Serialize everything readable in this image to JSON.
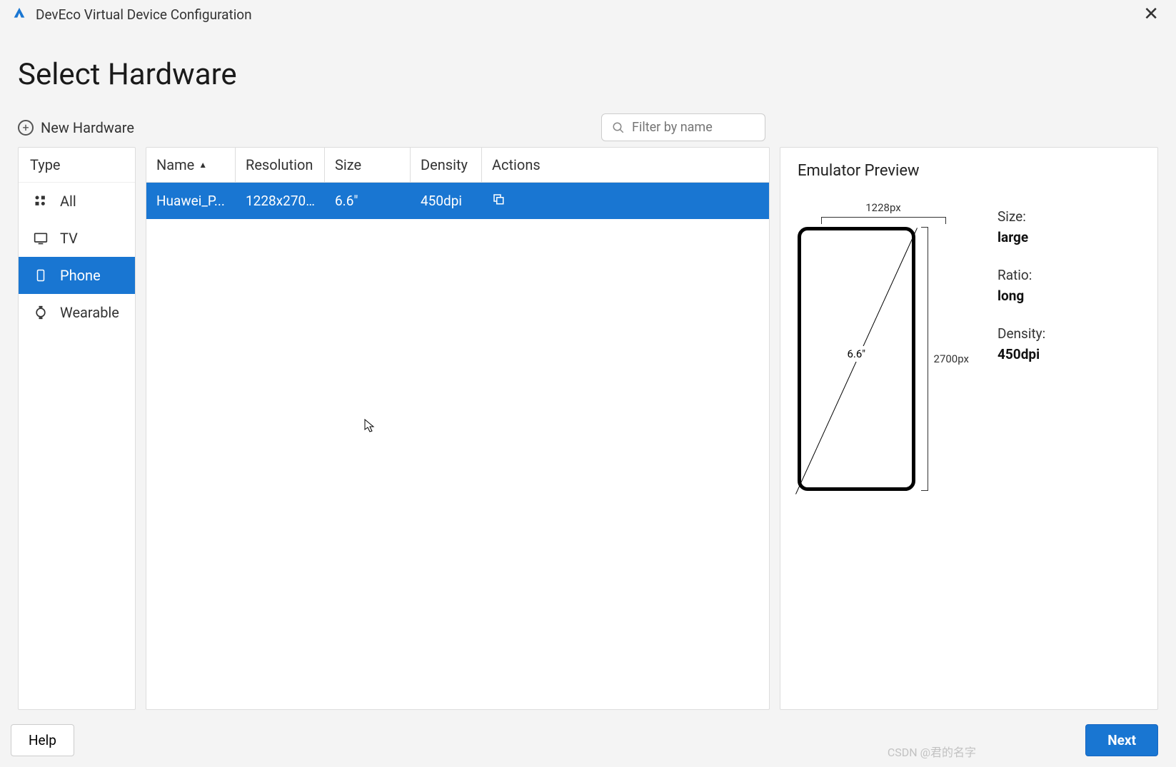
{
  "window": {
    "title": "DevEco Virtual Device Configuration"
  },
  "page": {
    "title": "Select Hardware"
  },
  "toolbar": {
    "new_hardware": "New Hardware",
    "search_placeholder": "Filter by name"
  },
  "sidebar": {
    "header": "Type",
    "items": [
      {
        "label": "All",
        "icon": "grid",
        "selected": false
      },
      {
        "label": "TV",
        "icon": "tv",
        "selected": false
      },
      {
        "label": "Phone",
        "icon": "phone",
        "selected": true
      },
      {
        "label": "Wearable",
        "icon": "watch",
        "selected": false
      }
    ]
  },
  "table": {
    "headers": {
      "name": "Name",
      "resolution": "Resolution",
      "size": "Size",
      "density": "Density",
      "actions": "Actions"
    },
    "rows": [
      {
        "name": "Huawei_P...",
        "resolution": "1228x270...",
        "size": "6.6\"",
        "density": "450dpi"
      }
    ]
  },
  "preview": {
    "title": "Emulator Preview",
    "width_label": "1228px",
    "height_label": "2700px",
    "diagonal_label": "6.6\"",
    "props": {
      "size_label": "Size:",
      "size_value": "large",
      "ratio_label": "Ratio:",
      "ratio_value": "long",
      "density_label": "Density:",
      "density_value": "450dpi"
    }
  },
  "footer": {
    "help": "Help",
    "next": "Next"
  },
  "watermark": "CSDN @君的名字"
}
